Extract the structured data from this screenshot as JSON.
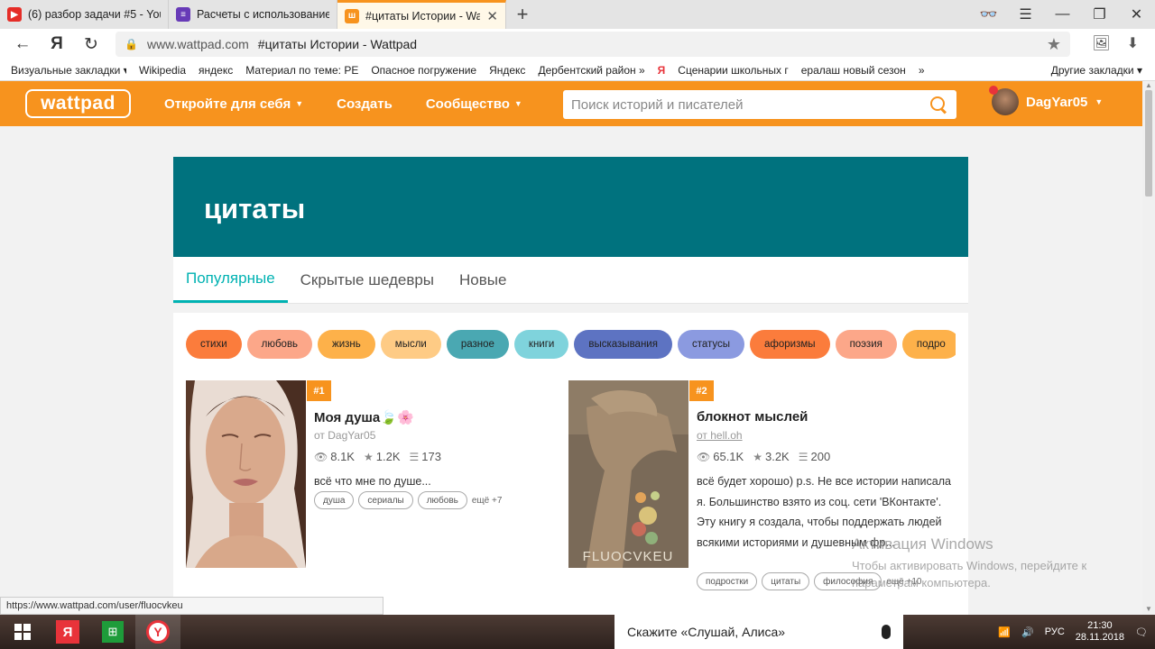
{
  "browser": {
    "tabs": [
      {
        "label": "(6) разбор задачи #5 - You",
        "icon": "youtube-icon",
        "color": "#e52d27",
        "active": false
      },
      {
        "label": "Расчеты с использование",
        "icon": "forms-icon",
        "color": "#673ab7",
        "active": false
      },
      {
        "label": "#цитаты Истории - Wat",
        "icon": "wattpad-icon",
        "color": "#f7931e",
        "active": true
      }
    ],
    "url_domain": "www.wattpad.com",
    "url_title": "#цитаты Истории - Wattpad",
    "bookmarks": [
      "Визуальные закладки ▾",
      "Wikipedia",
      "яндекс",
      "Материал по теме: РЕ",
      "Опасное погружение",
      "Яндекс",
      "Дербентский район »",
      "Сценарии школьных г",
      "ералаш новый сезон",
      "»"
    ],
    "bookmarks_other": "Другие закладки ▾",
    "status_url": "https://www.wattpad.com/user/fluocvkeu"
  },
  "wattpad": {
    "logo": "wattpad",
    "nav": {
      "discover": "Откройте для себя",
      "create": "Создать",
      "community": "Сообщество"
    },
    "search_placeholder": "Поиск историй и писателей",
    "username": "DagYar05"
  },
  "tag_page": {
    "title": "цитаты",
    "tabs": [
      "Популярные",
      "Скрытые шедевры",
      "Новые"
    ],
    "active_tab": 0,
    "chips": [
      {
        "label": "стихи",
        "color": "#fb7c3c"
      },
      {
        "label": "любовь",
        "color": "#fca789"
      },
      {
        "label": "жизнь",
        "color": "#fdb14a"
      },
      {
        "label": "мысли",
        "color": "#fecb85"
      },
      {
        "label": "разное",
        "color": "#4aa8b2"
      },
      {
        "label": "книги",
        "color": "#7fd3dc"
      },
      {
        "label": "высказывания",
        "color": "#5d73c2"
      },
      {
        "label": "статусы",
        "color": "#8b9ae0"
      },
      {
        "label": "афоризмы",
        "color": "#fb7c3c"
      },
      {
        "label": "поэзия",
        "color": "#fca789"
      },
      {
        "label": "подро",
        "color": "#fdb14a"
      }
    ],
    "stories": [
      {
        "rank": "#1",
        "title": "Моя душа🍃🌸",
        "author": "от DagYar05",
        "reads": "8.1K",
        "votes": "1.2K",
        "parts": "173",
        "description": "всё что мне по душе...",
        "tags": [
          "душа",
          "сериалы",
          "любовь"
        ],
        "more": "ещё +7"
      },
      {
        "rank": "#2",
        "title": "блокнот мыслей",
        "author": "от hell.oh",
        "reads": "65.1K",
        "votes": "3.2K",
        "parts": "200",
        "description": "всё будет хорошо) p.s. Не все истории написала я. Большинство взято из соц. сети 'ВКонтакте'. Эту книгу я создала, чтобы поддержать людей всякими историями и душевным фр...",
        "tags": [
          "подростки",
          "цитаты",
          "философия"
        ],
        "more": "ещё +10",
        "cover_text": "FLUOCVKEU"
      }
    ]
  },
  "watermark": {
    "line1": "Активация Windows",
    "line2": "Чтобы активировать Windows, перейдите к параметрам компьютера."
  },
  "taskbar": {
    "alice": "Скажите «Слушай, Алиса»",
    "lang": "РУС",
    "time": "21:30",
    "date": "28.11.2018"
  }
}
